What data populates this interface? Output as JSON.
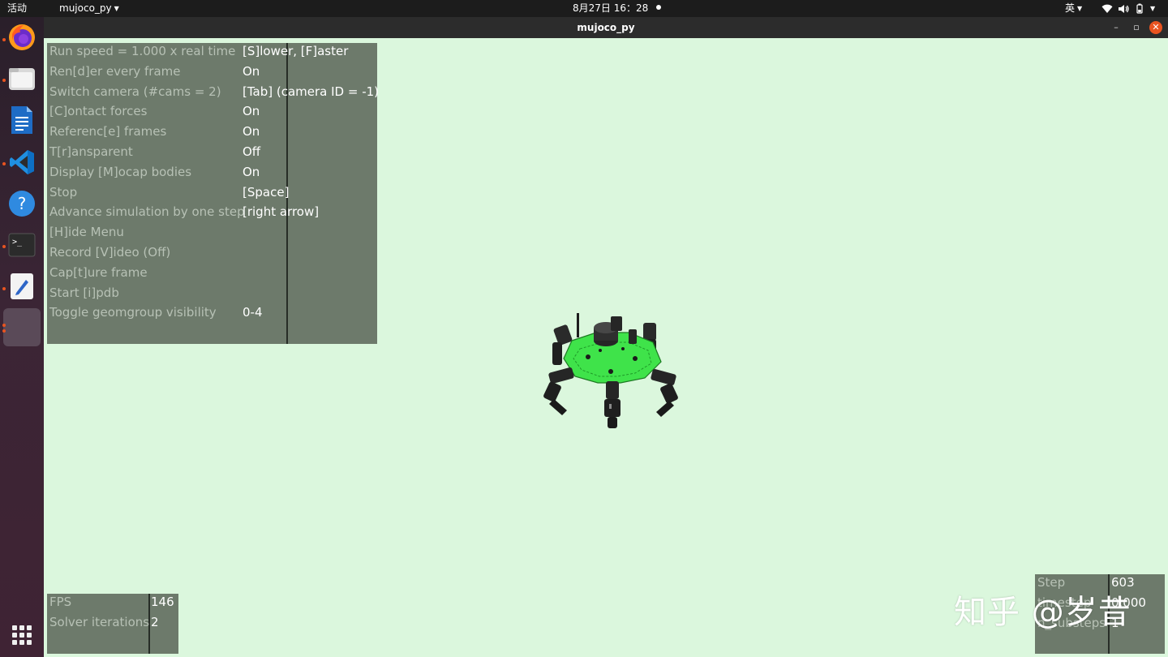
{
  "topbar": {
    "activities": "活动",
    "app_menu": "mujoco_py",
    "clock": "8月27日 16：28",
    "input_method": "英"
  },
  "dock": {
    "icons": [
      "firefox-icon",
      "files-icon",
      "writer-icon",
      "vscode-icon",
      "help-icon",
      "terminal-icon",
      "text-editor-icon",
      "active-window-icon",
      "show-apps-icon"
    ]
  },
  "window": {
    "title": "mujoco_py"
  },
  "menu": {
    "rows": [
      {
        "label": "Run speed = 1.000 x real time",
        "value": "[S]lower, [F]aster"
      },
      {
        "label": "Ren[d]er every frame",
        "value": "On"
      },
      {
        "label": "Switch camera (#cams = 2)",
        "value": "[Tab] (camera ID = -1)"
      },
      {
        "label": "[C]ontact forces",
        "value": "On"
      },
      {
        "label": "Referenc[e] frames",
        "value": "On"
      },
      {
        "label": "T[r]ansparent",
        "value": "Off"
      },
      {
        "label": "Display [M]ocap bodies",
        "value": "On"
      },
      {
        "label": "Stop",
        "value": "[Space]"
      },
      {
        "label": "Advance simulation by one step",
        "value": "[right arrow]"
      },
      {
        "label": "[H]ide Menu",
        "value": ""
      },
      {
        "label": "Record [V]ideo (Off)",
        "value": ""
      },
      {
        "label": "Cap[t]ure frame",
        "value": ""
      },
      {
        "label": "Start [i]pdb",
        "value": ""
      },
      {
        "label": "Toggle geomgroup visibility",
        "value": "0-4"
      }
    ]
  },
  "stats_left": {
    "rows": [
      {
        "label": "FPS",
        "value": "146"
      },
      {
        "label": "Solver iterations",
        "value": "2"
      }
    ]
  },
  "stats_right": {
    "rows": [
      {
        "label": "Step",
        "value": "603"
      },
      {
        "label": "timestep",
        "value": "0.000"
      },
      {
        "label": "n_substeps",
        "value": "1"
      }
    ]
  },
  "watermark": "知乎 @岁昔",
  "colors": {
    "background": "#dbf7dd",
    "overlay_panel": "#6d7a6b",
    "robot_body": "#3fe34a",
    "ubuntu_orange": "#e95420"
  }
}
